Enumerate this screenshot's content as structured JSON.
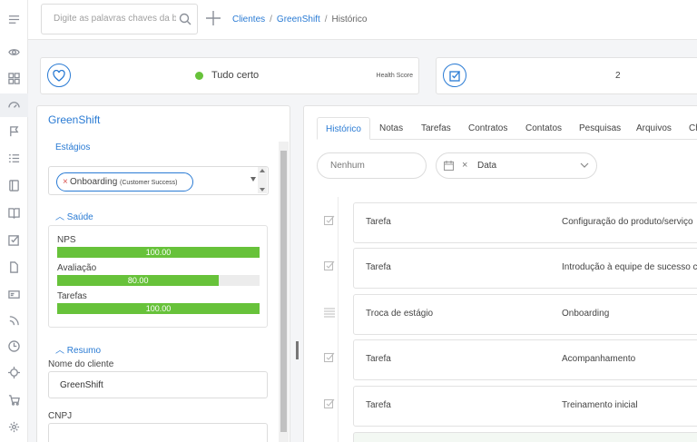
{
  "topbar": {
    "search_placeholder": "Digite as palavras chaves da busca",
    "breadcrumb": [
      {
        "label": "Clientes",
        "link": true
      },
      {
        "label": "GreenShift",
        "link": true
      },
      {
        "label": "Histórico",
        "link": false
      }
    ],
    "separator": "/"
  },
  "status_card": {
    "status_text": "Tudo certo",
    "status_color": "#67c23a",
    "health_label": "Health Score"
  },
  "tasks_card": {
    "count": "2"
  },
  "client_panel": {
    "title": "GreenShift",
    "stages_label": "Estágios",
    "stage_chip": {
      "remove": "×",
      "name": "Onboarding",
      "qualifier": "(Customer Success)"
    },
    "health_section": "Saúde",
    "health_items": [
      {
        "label": "NPS",
        "value_text": "100.00",
        "percent": 100
      },
      {
        "label": "Avaliação",
        "value_text": "80.00",
        "percent": 80
      },
      {
        "label": "Tarefas",
        "value_text": "100.00",
        "percent": 100
      }
    ],
    "summary_section": "Resumo",
    "client_name_label": "Nome do cliente",
    "client_name_value": "GreenShift",
    "cnpj_label": "CNPJ",
    "cnpj_value": ""
  },
  "history_panel": {
    "tabs": [
      "Histórico",
      "Notas",
      "Tarefas",
      "Contratos",
      "Contatos",
      "Pesquisas",
      "Arquivos",
      "Ch"
    ],
    "active_tab": "Histórico",
    "filter_placeholder": "Nenhum",
    "date_filter": {
      "clear": "×",
      "label": "Data"
    },
    "entries": [
      {
        "icon": "check-icon",
        "type": "Tarefa",
        "description": "Configuração do produto/serviço"
      },
      {
        "icon": "check-icon",
        "type": "Tarefa",
        "description": "Introdução à equipe de sucesso c"
      },
      {
        "icon": "list-icon",
        "type": "Troca de estágio",
        "description": "Onboarding"
      },
      {
        "icon": "check-icon",
        "type": "Tarefa",
        "description": "Acompanhamento"
      },
      {
        "icon": "check-icon",
        "type": "Tarefa",
        "description": "Treinamento inicial"
      }
    ]
  },
  "colors": {
    "accent": "#2a7bd4",
    "success": "#67c23a"
  },
  "sidebar_icons": [
    "menu-icon",
    "eye-icon",
    "dashboard-icon",
    "health-icon",
    "flag-icon",
    "list-icon",
    "journey-icon",
    "book-icon",
    "task-icon",
    "document-icon",
    "card-icon",
    "feed-icon",
    "clock-icon",
    "target-icon",
    "cart-icon",
    "gear-icon"
  ]
}
